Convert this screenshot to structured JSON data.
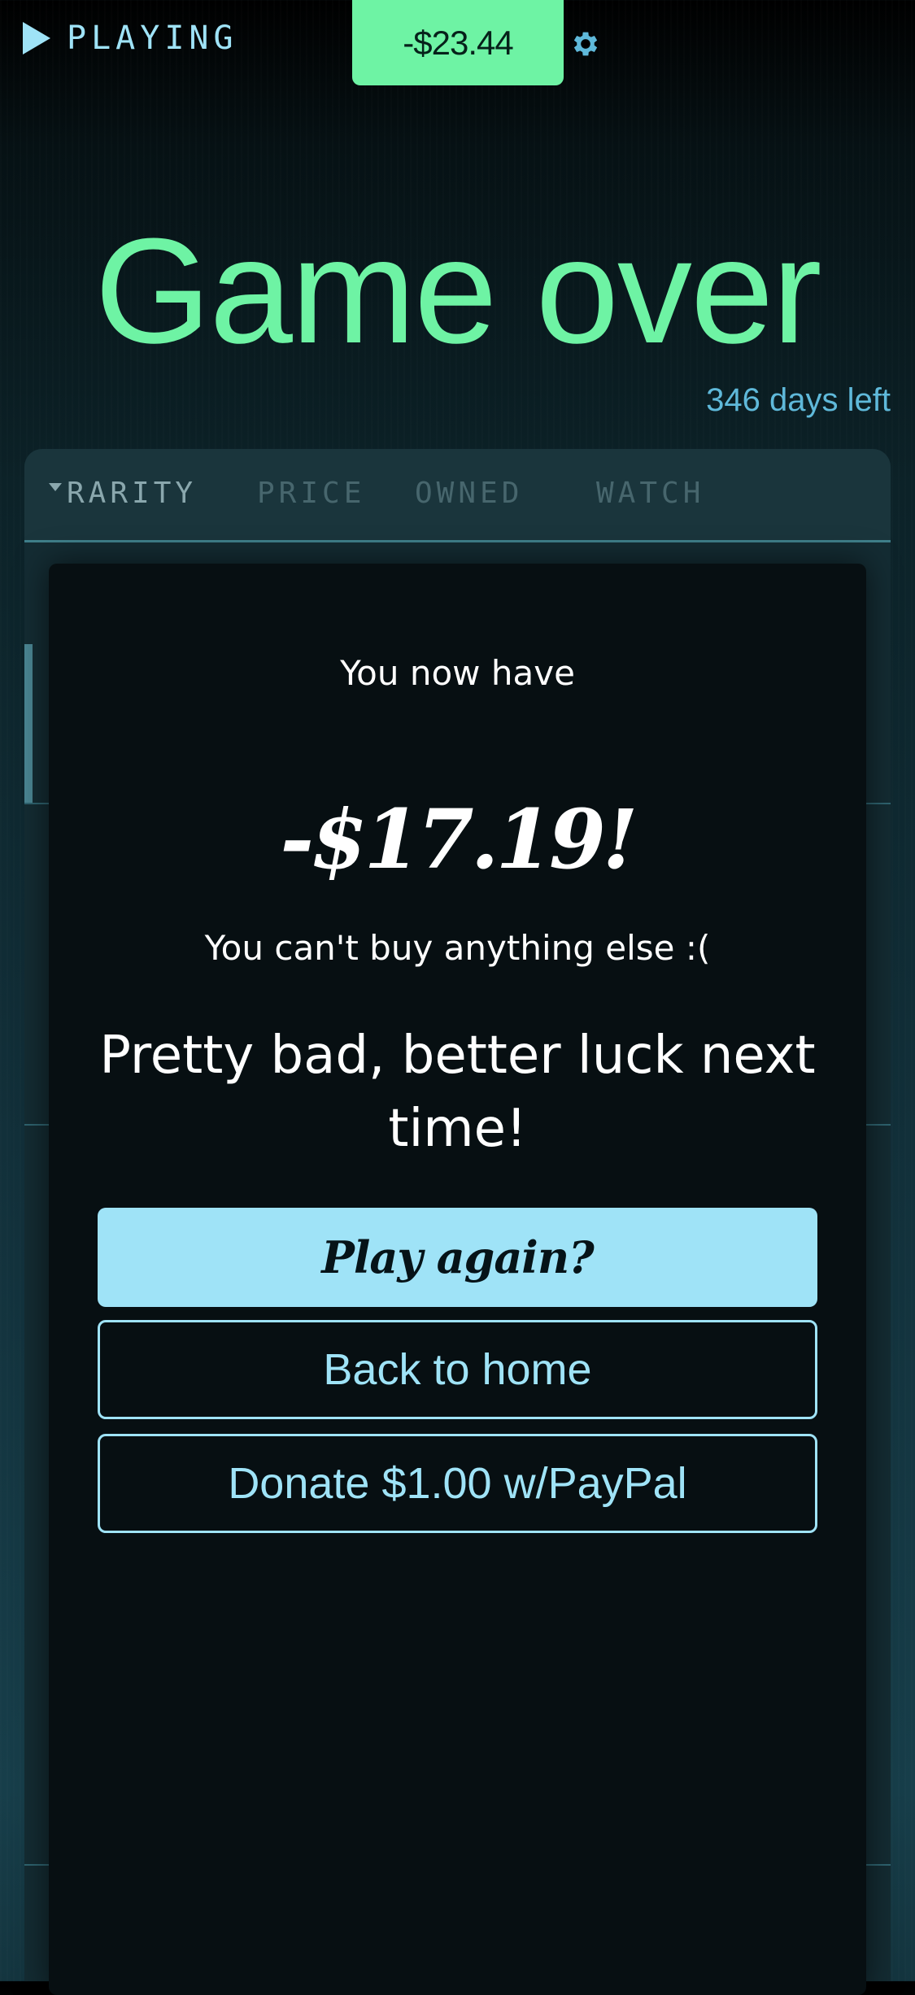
{
  "header": {
    "status_label": "PLAYING",
    "balance": "-$23.44",
    "settings_icon": "gear-icon",
    "play_icon": "play-icon"
  },
  "title": "Game over",
  "days_left": "346 days left",
  "table": {
    "columns": [
      "RARITY",
      "PRICE",
      "OWNED",
      "WATCH"
    ],
    "sorted_column": "RARITY"
  },
  "modal": {
    "lead": "You now have",
    "amount": "-$17.19!",
    "message": "You can't buy anything else :(",
    "verdict": "Pretty bad, better luck next time!",
    "buttons": {
      "play_again": "Play again?",
      "home": "Back to home",
      "donate": "Donate $1.00 w/PayPal"
    }
  },
  "colors": {
    "accent_green": "#6ef3a4",
    "accent_blue": "#9fe3f7",
    "days_left_blue": "#5fb9da",
    "modal_bg": "#070f12"
  }
}
